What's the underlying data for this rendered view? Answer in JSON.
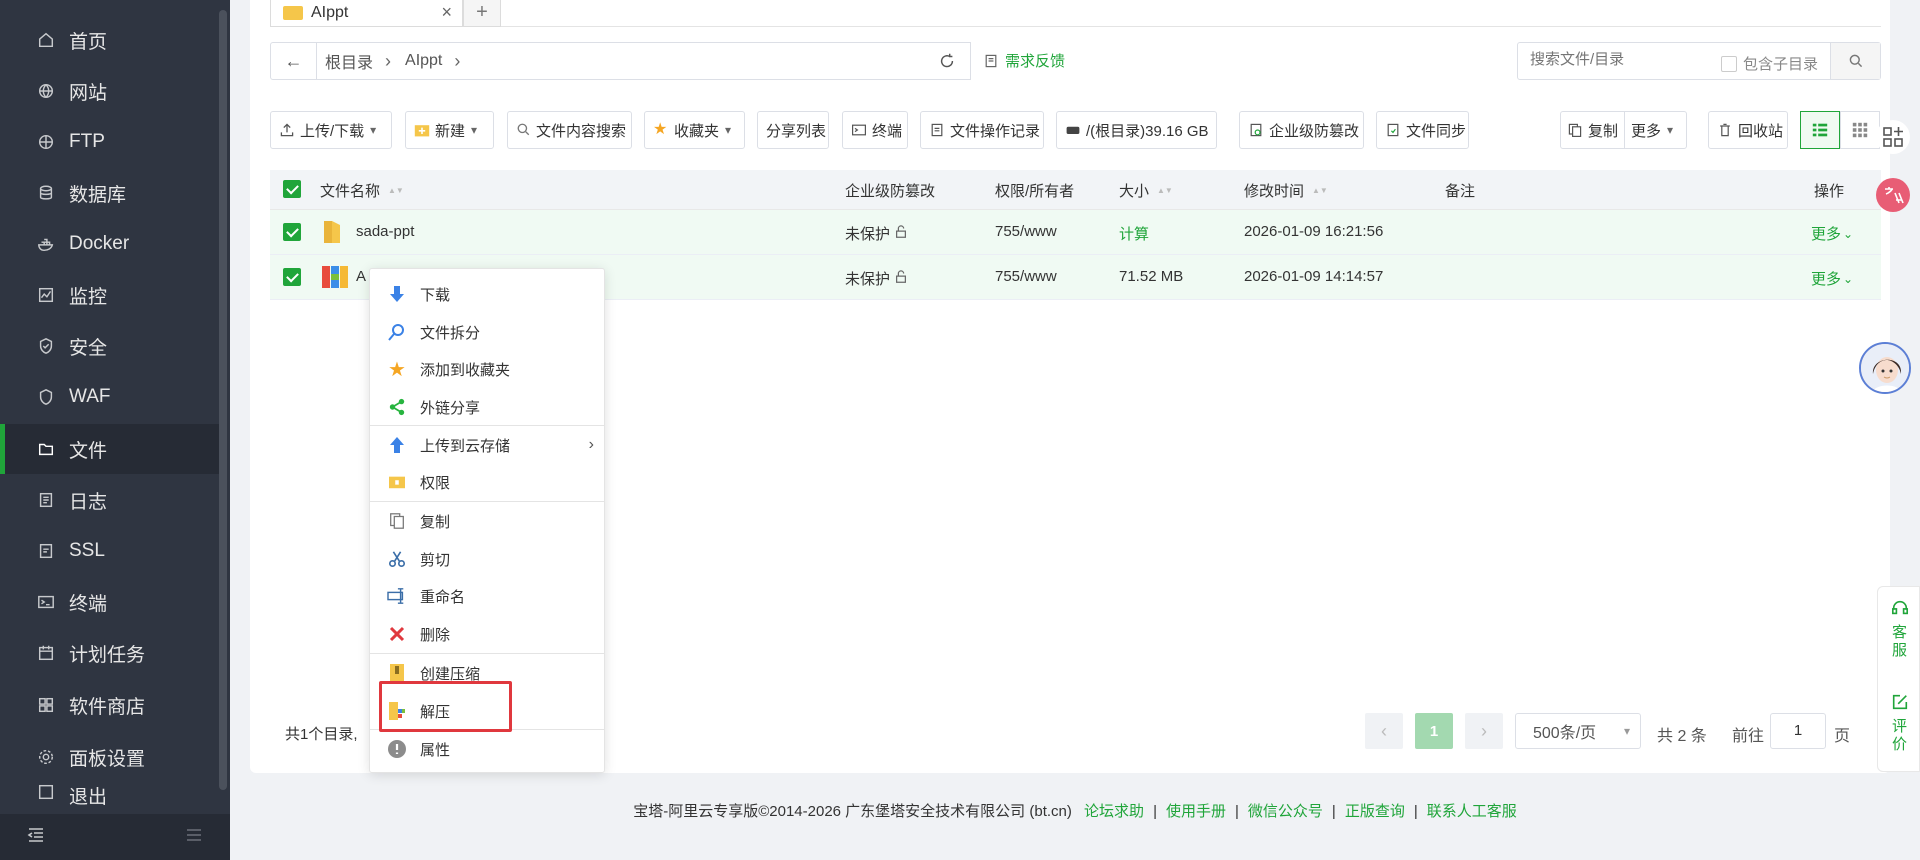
{
  "sidebar": {
    "items": [
      {
        "label": "首页",
        "icon": "home-icon"
      },
      {
        "label": "网站",
        "icon": "globe-icon"
      },
      {
        "label": "FTP",
        "icon": "ftp-icon"
      },
      {
        "label": "数据库",
        "icon": "database-icon"
      },
      {
        "label": "Docker",
        "icon": "docker-icon"
      },
      {
        "label": "监控",
        "icon": "monitor-icon"
      },
      {
        "label": "安全",
        "icon": "shield-icon"
      },
      {
        "label": "WAF",
        "icon": "waf-icon"
      },
      {
        "label": "文件",
        "icon": "folder-icon",
        "active": true
      },
      {
        "label": "日志",
        "icon": "log-icon"
      },
      {
        "label": "SSL",
        "icon": "ssl-icon"
      },
      {
        "label": "终端",
        "icon": "terminal-icon"
      },
      {
        "label": "计划任务",
        "icon": "calendar-icon"
      },
      {
        "label": "软件商店",
        "icon": "store-icon"
      },
      {
        "label": "面板设置",
        "icon": "gear-icon"
      },
      {
        "label": "退出",
        "icon": "logout-icon"
      }
    ]
  },
  "tabs": {
    "active": "AIppt",
    "close": "×",
    "add": "+"
  },
  "path": {
    "crumbs": [
      "根目录",
      "AIppt"
    ],
    "sep": "›"
  },
  "feedback": "需求反馈",
  "search": {
    "placeholder": "搜索文件/目录",
    "include_sub": "包含子目录"
  },
  "toolbar": {
    "upload": "上传/下载",
    "new": "新建",
    "content_search": "文件内容搜索",
    "favorites": "收藏夹",
    "share_list": "分享列表",
    "terminal": "终端",
    "op_log": "文件操作记录",
    "disk": "/(根目录)39.16 GB",
    "tamper": "企业级防篡改",
    "sync": "文件同步",
    "copy": "复制",
    "more": "更多",
    "recycle": "回收站"
  },
  "table": {
    "headers": {
      "name": "文件名称",
      "tamper": "企业级防篡改",
      "perm": "权限/所有者",
      "size": "大小",
      "mtime": "修改时间",
      "note": "备注",
      "op": "操作"
    },
    "rows": [
      {
        "name": "sada-ppt",
        "tamper": "未保护",
        "perm": "755/www",
        "size": "计算",
        "mtime": "2026-01-09 16:21:56",
        "op": "更多"
      },
      {
        "name": "A",
        "tamper": "未保护",
        "perm": "755/www",
        "size": "71.52 MB",
        "mtime": "2026-01-09 14:14:57",
        "op": "更多"
      }
    ]
  },
  "summary": "共1个目录,",
  "pager": {
    "current": "1",
    "per_page": "500条/页",
    "total": "共 2 条",
    "goto": "前往",
    "goto_value": "1",
    "page_unit": "页",
    "prev": "‹",
    "next": "›"
  },
  "context_menu": [
    "下载",
    "文件拆分",
    "添加到收藏夹",
    "外链分享",
    "上传到云存储",
    "权限",
    "复制",
    "剪切",
    "重命名",
    "删除",
    "创建压缩",
    "解压",
    "属性"
  ],
  "float": {
    "service": "客服",
    "rate": "评价"
  },
  "footer": {
    "copyright": "宝塔-阿里云专享版©2014-2026 广东堡塔安全技术有限公司 (bt.cn)",
    "links": [
      "论坛求助",
      "使用手册",
      "微信公众号",
      "正版查询",
      "联系人工客服"
    ]
  },
  "colors": {
    "accent": "#20a53a",
    "sidebar": "#2f3541",
    "highlight": "#e0383e"
  }
}
